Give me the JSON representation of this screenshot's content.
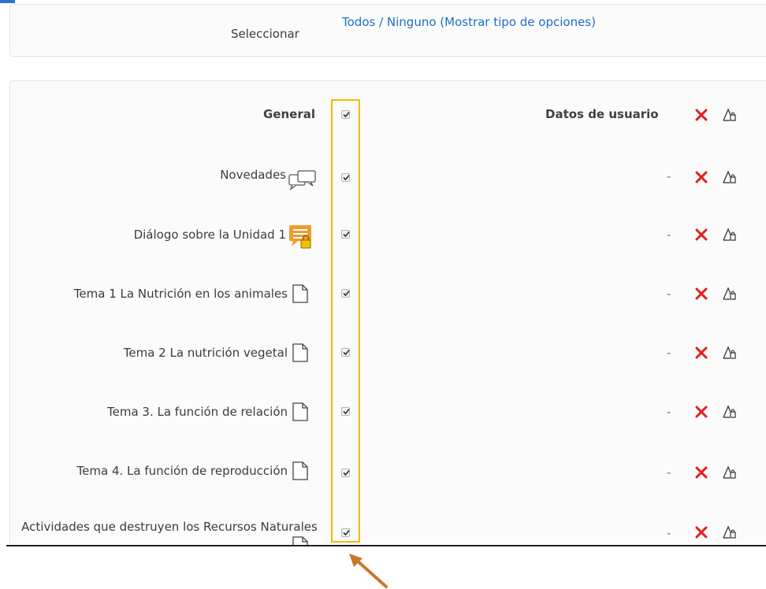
{
  "select": {
    "label": "Seleccionar",
    "all": "Todos",
    "separator": " / ",
    "none": "Ninguno",
    "show_types": " (Mostrar tipo de opciones)"
  },
  "general": {
    "label": "General",
    "user_data_label": "Datos de usuario",
    "checked": true
  },
  "rows": [
    {
      "label": "Novedades",
      "icon": "forum-icon",
      "checked": true,
      "user_data": "-"
    },
    {
      "label": "Diálogo sobre la Unidad 1",
      "icon": "locked-forum-icon",
      "checked": true,
      "user_data": "-"
    },
    {
      "label": "Tema 1 La Nutrición en los animales",
      "icon": "page-icon",
      "checked": true,
      "user_data": "-"
    },
    {
      "label": "Tema 2 La nutrición vegetal",
      "icon": "page-icon",
      "checked": true,
      "user_data": "-"
    },
    {
      "label": "Tema 3. La función de relación",
      "icon": "page-icon",
      "checked": true,
      "user_data": "-"
    },
    {
      "label": "Tema 4. La función de reproducción",
      "icon": "page-icon",
      "checked": true,
      "user_data": "-"
    },
    {
      "label": "Actividades que destruyen los Recursos Naturales",
      "icon": "page-icon",
      "checked": true,
      "user_data": "-"
    }
  ],
  "colors": {
    "link": "#1b6fc7",
    "highlight": "#f5b800",
    "delete_icon": "#e02020",
    "arrow": "#c9772a"
  }
}
